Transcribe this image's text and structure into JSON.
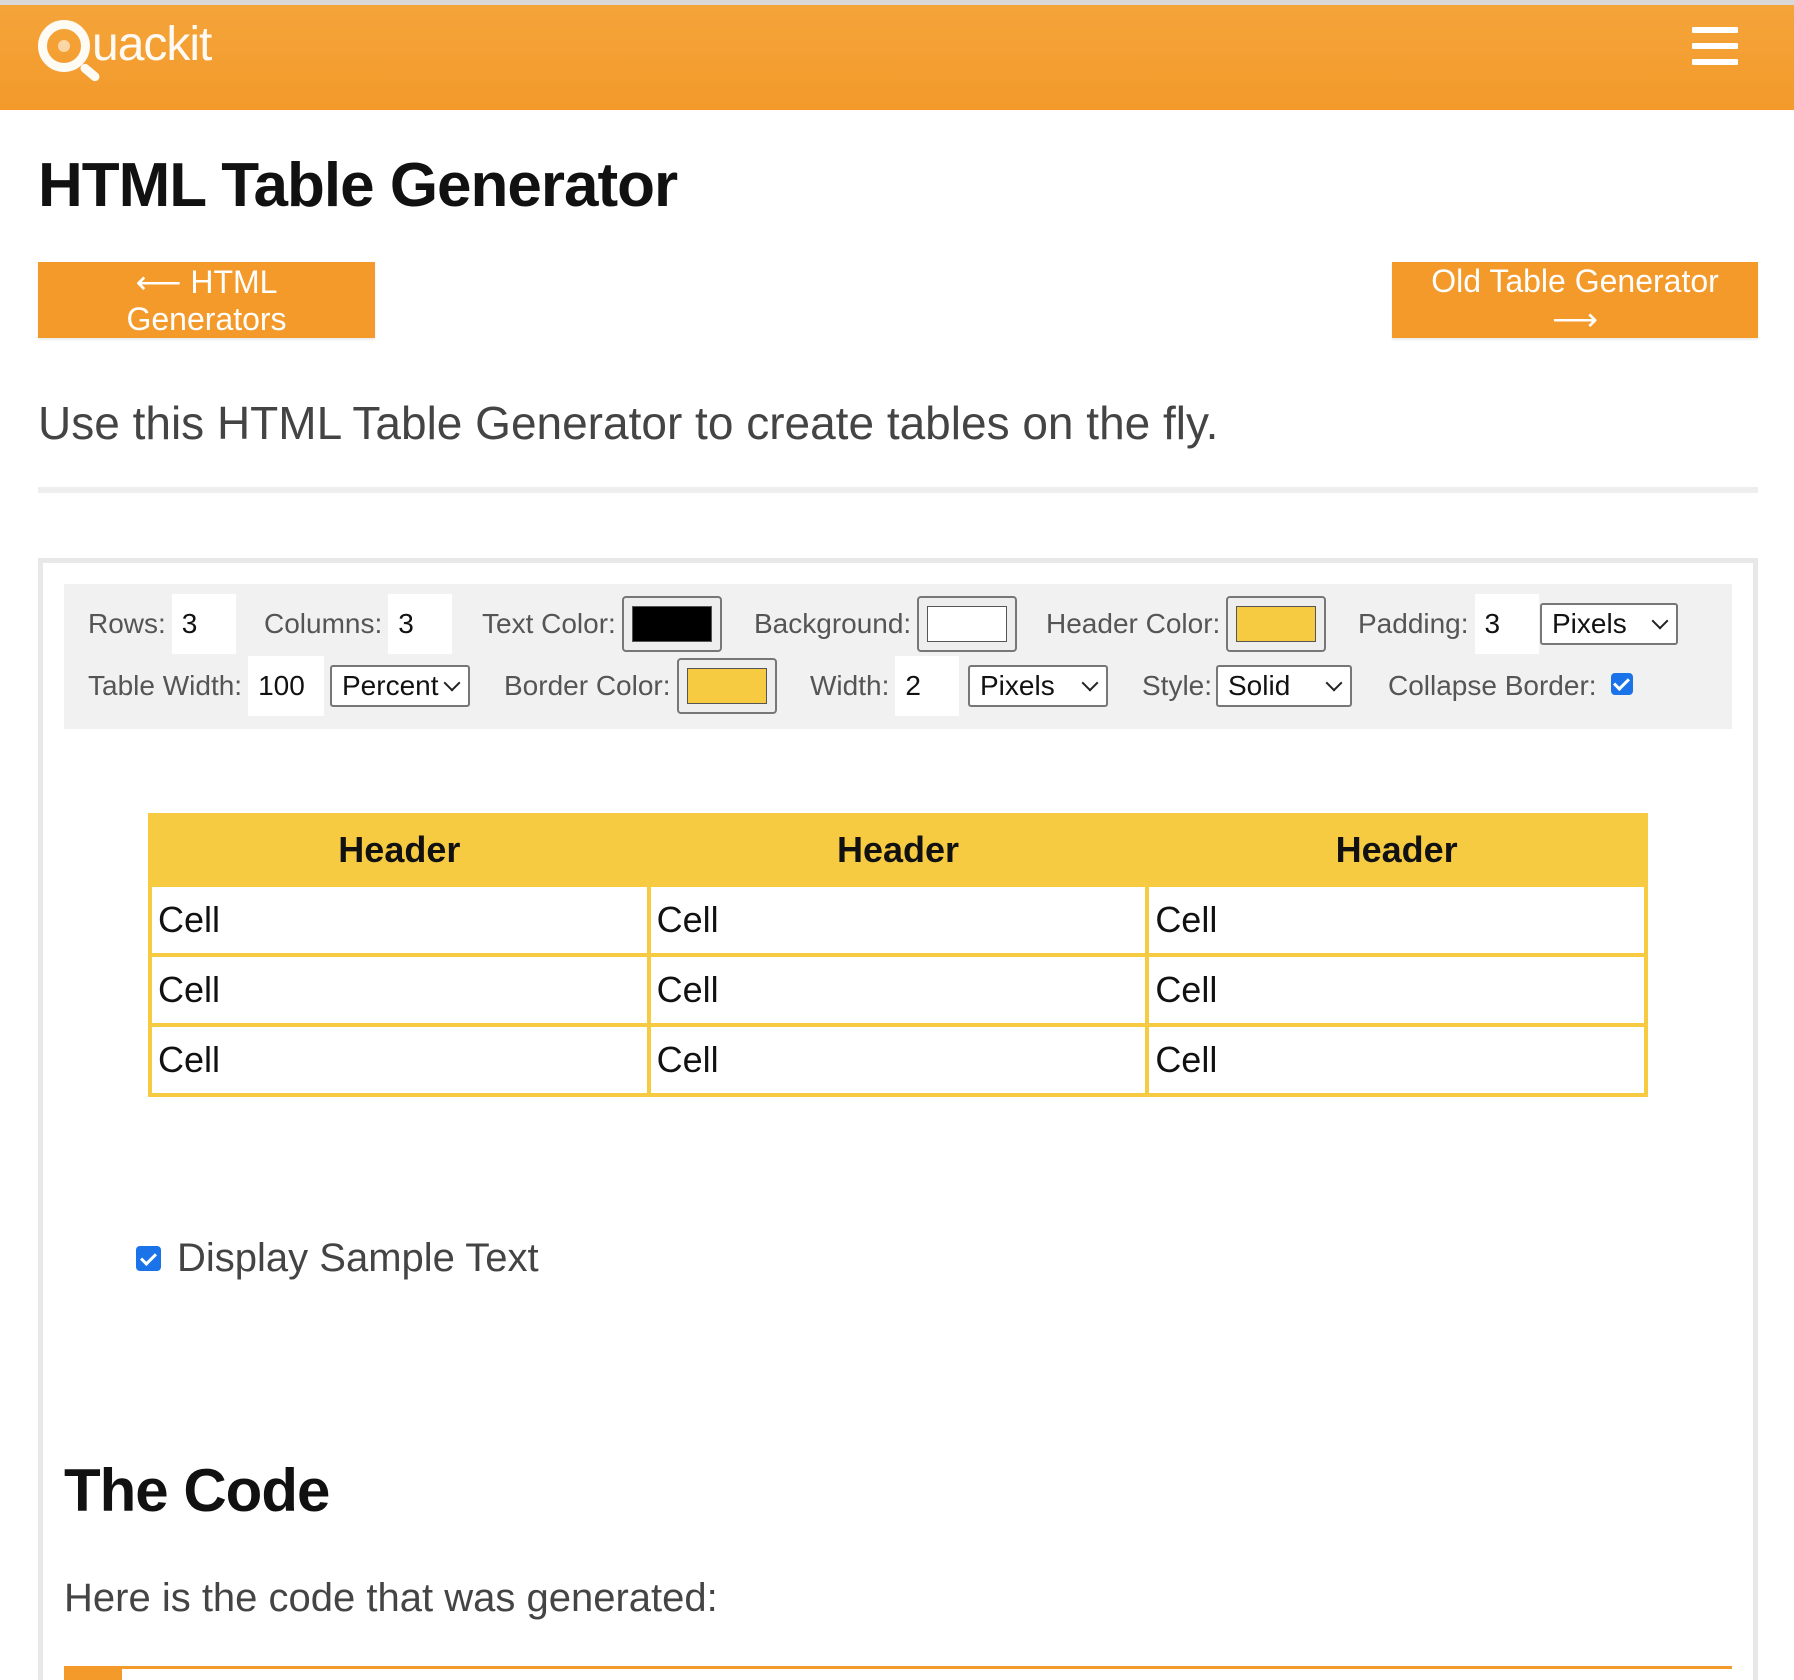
{
  "header": {
    "logo_text": "uackit",
    "brand_color": "#f39a2b",
    "menu_icon": "hamburger-menu-icon"
  },
  "page": {
    "title": "HTML Table Generator",
    "back_button": "⟵ HTML Generators",
    "old_button": "Old Table Generator ⟶",
    "intro": "Use this HTML Table Generator to create tables on the fly."
  },
  "controls": {
    "rows_label": "Rows:",
    "rows_value": "3",
    "columns_label": "Columns:",
    "columns_value": "3",
    "text_color_label": "Text Color:",
    "text_color": "#000000",
    "background_label": "Background:",
    "background_color": "#ffffff",
    "header_color_label": "Header Color:",
    "header_color": "#f6cb42",
    "padding_label": "Padding:",
    "padding_value": "3",
    "padding_unit": "Pixels",
    "table_width_label": "Table Width:",
    "table_width_value": "100",
    "table_width_unit": "Percent",
    "border_color_label": "Border Color:",
    "border_color": "#f6cb42",
    "border_width_label": "Width:",
    "border_width_value": "2",
    "border_width_unit": "Pixels",
    "style_label": "Style:",
    "style_value": "Solid",
    "collapse_label": "Collapse Border:",
    "collapse_checked": true
  },
  "preview_table": {
    "headers": [
      "Header",
      "Header",
      "Header"
    ],
    "rows": [
      [
        "Cell",
        "Cell",
        "Cell"
      ],
      [
        "Cell",
        "Cell",
        "Cell"
      ],
      [
        "Cell",
        "Cell",
        "Cell"
      ]
    ]
  },
  "sample_text": {
    "label": "Display Sample Text",
    "checked": true
  },
  "code_section": {
    "title": "The Code",
    "intro": "Here is the code that was generated:"
  }
}
